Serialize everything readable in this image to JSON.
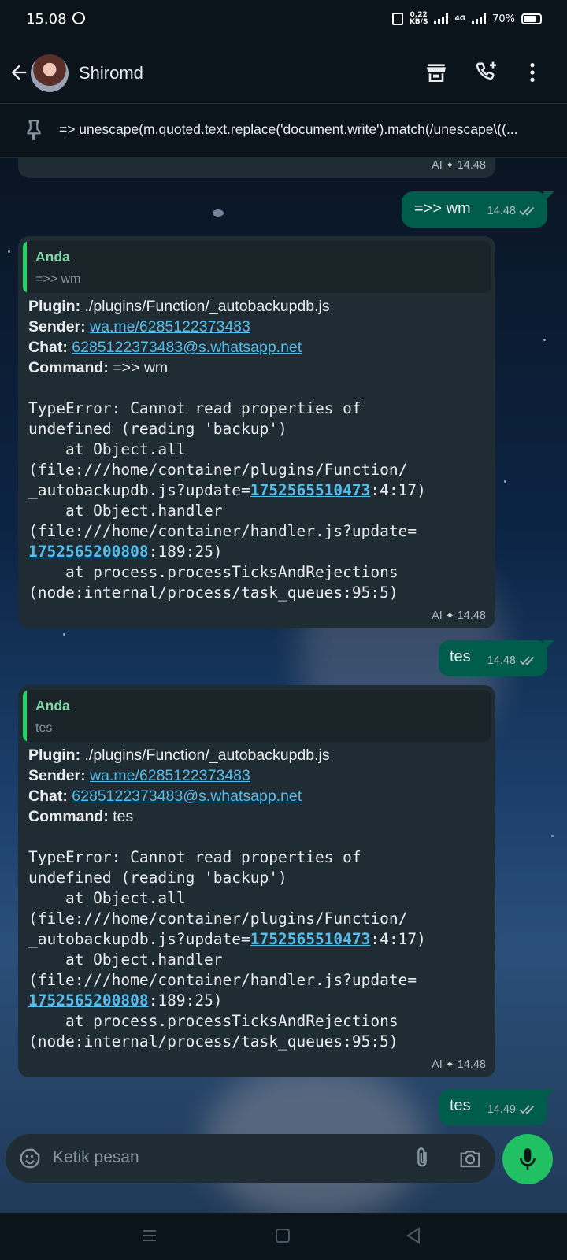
{
  "status_bar": {
    "time": "15.08",
    "speed_value": "0,22",
    "speed_unit": "KB/S",
    "network": "4G",
    "battery": "70%"
  },
  "header": {
    "contact_name": "Shiromd"
  },
  "pinned": {
    "text": "=> unescape(m.quoted.text.replace('document.write').match(/unescape\\((..."
  },
  "messages": {
    "top_partial": {
      "ai": "AI",
      "time": "14.48"
    },
    "out1": {
      "text": "=>> wm",
      "time": "14.48"
    },
    "in1": {
      "quote_name": "Anda",
      "quote_text": "=>> wm",
      "plugin_label": "Plugin:",
      "plugin_value": "./plugins/Function/_autobackupdb.js",
      "sender_label": "Sender:",
      "sender_value": "wa.me/6285122373483",
      "chat_label": "Chat:",
      "chat_value": "6285122373483@s.whatsapp.net",
      "command_label": "Command:",
      "command_value": "=>> wm",
      "error_1": "TypeError: Cannot read properties of",
      "error_2": "undefined (reading 'backup')",
      "error_3": "    at Object.all",
      "error_4": "(file:///home/container/plugins/Function/",
      "error_5a": "_autobackupdb.js?update=",
      "error_5_num": "1752565510473",
      "error_5b": ":4:17)",
      "error_6": "    at Object.handler",
      "error_7": "(file:///home/container/handler.js?update=",
      "error_8_num": "1752565200808",
      "error_8b": ":189:25)",
      "error_9": "    at process.processTicksAndRejections",
      "error_10": "(node:internal/process/task_queues:95:5)",
      "ai": "AI",
      "time": "14.48"
    },
    "out2": {
      "text": "tes",
      "time": "14.48"
    },
    "in2": {
      "quote_name": "Anda",
      "quote_text": "tes",
      "plugin_label": "Plugin:",
      "plugin_value": "./plugins/Function/_autobackupdb.js",
      "sender_label": "Sender:",
      "sender_value": "wa.me/6285122373483",
      "chat_label": "Chat:",
      "chat_value": "6285122373483@s.whatsapp.net",
      "command_label": "Command:",
      "command_value": "tes",
      "error_1": "TypeError: Cannot read properties of",
      "error_2": "undefined (reading 'backup')",
      "error_3": "    at Object.all",
      "error_4": "(file:///home/container/plugins/Function/",
      "error_5a": "_autobackupdb.js?update=",
      "error_5_num": "1752565510473",
      "error_5b": ":4:17)",
      "error_6": "    at Object.handler",
      "error_7": "(file:///home/container/handler.js?update=",
      "error_8_num": "1752565200808",
      "error_8b": ":189:25)",
      "error_9": "    at process.processTicksAndRejections",
      "error_10": "(node:internal/process/task_queues:95:5)",
      "ai": "AI",
      "time": "14.48"
    },
    "out3": {
      "text": "tes",
      "time": "14.49"
    }
  },
  "composer": {
    "placeholder": "Ketik pesan"
  },
  "colors": {
    "outgoing_bubble": "#005c4b",
    "incoming_bubble": "#202c33",
    "accent_green": "#21c063",
    "link": "#53bdeb",
    "read_ticks": "#aebac1"
  },
  "icons": [
    "back-arrow-icon",
    "shop-icon",
    "add-call-icon",
    "more-vert-icon",
    "pin-icon",
    "emoji-icon",
    "attach-icon",
    "camera-icon",
    "mic-icon",
    "ai-sparkle-icon",
    "double-check-icon"
  ]
}
